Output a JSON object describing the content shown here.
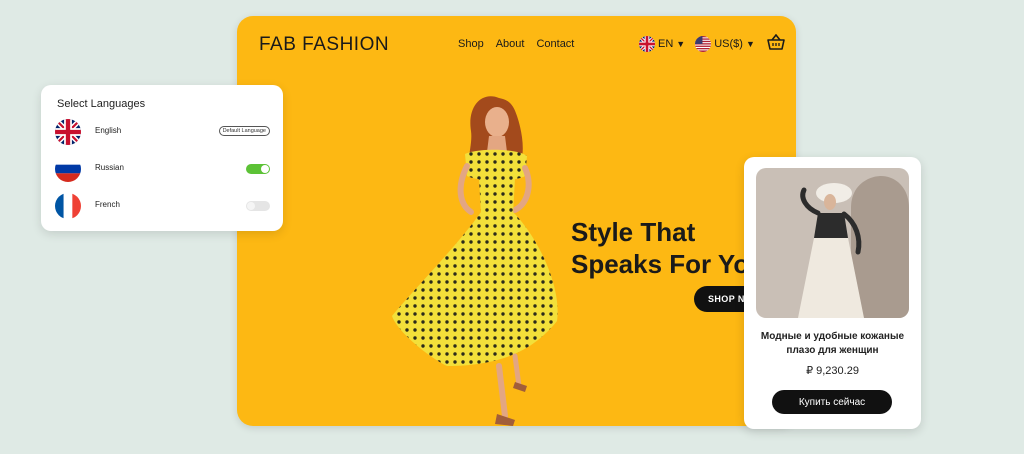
{
  "site": {
    "logo": "FAB FASHION",
    "nav": [
      "Shop",
      "About",
      "Contact"
    ],
    "language_selector": "EN",
    "currency_selector": "US($)",
    "hero_title_line1": "Style That",
    "hero_title_line2": "Speaks For Yo",
    "shop_now_label": "SHOP NO"
  },
  "language_panel": {
    "title": "Select Languages",
    "languages": [
      {
        "name": "English",
        "badge": "Default Language"
      },
      {
        "name": "Russian",
        "enabled": true
      },
      {
        "name": "French",
        "enabled": false
      }
    ]
  },
  "product_card": {
    "name": "Модные и удобные кожаные плазо для женщин",
    "price": "₽ 9,230.29",
    "buy_label": "Купить сейчас"
  },
  "colors": {
    "hero_bg": "#fdb813",
    "page_bg": "#dfeae5",
    "toggle_on": "#5cc236",
    "button_dark": "#111111"
  }
}
